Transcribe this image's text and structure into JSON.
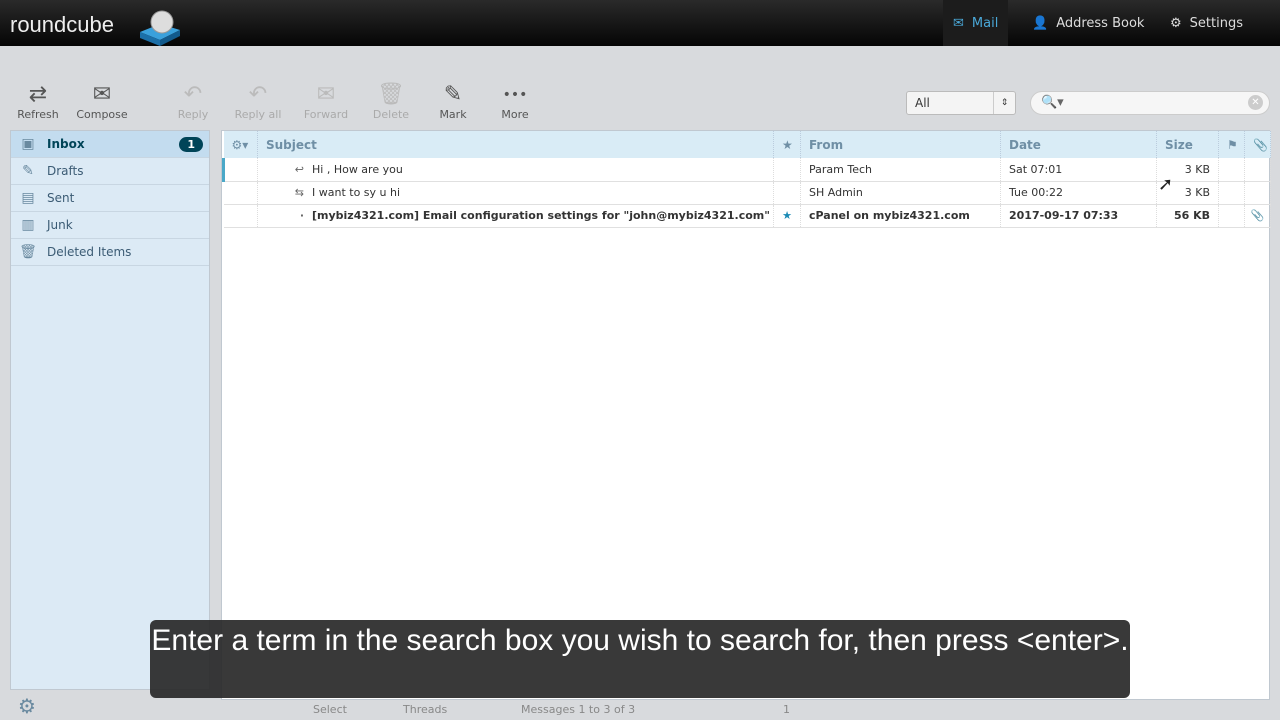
{
  "app": {
    "logo": "roundcube"
  },
  "topnav": [
    {
      "label": "Mail",
      "icon": "envelope-icon",
      "active": true
    },
    {
      "label": "Address Book",
      "icon": "person-icon"
    },
    {
      "label": "Settings",
      "icon": "gear-icon"
    }
  ],
  "toolbar": [
    {
      "label": "Refresh",
      "icon": "⇄",
      "enabled": true
    },
    {
      "label": "Compose",
      "icon": "✉",
      "enabled": true
    },
    {
      "label": "Reply",
      "icon": "↶",
      "enabled": false
    },
    {
      "label": "Reply all",
      "icon": "↶",
      "enabled": false
    },
    {
      "label": "Forward",
      "icon": "✉",
      "enabled": false
    },
    {
      "label": "Delete",
      "icon": "🗑",
      "enabled": false
    },
    {
      "label": "Mark",
      "icon": "✎",
      "enabled": true
    },
    {
      "label": "More",
      "icon": "•••",
      "enabled": true
    }
  ],
  "filter": {
    "value": "All"
  },
  "search": {
    "value": ""
  },
  "folders": [
    {
      "label": "Inbox",
      "count": "1",
      "icon": "▣"
    },
    {
      "label": "Drafts",
      "icon": "✎"
    },
    {
      "label": "Sent",
      "icon": "▤"
    },
    {
      "label": "Junk",
      "icon": "▥"
    },
    {
      "label": "Deleted Items",
      "icon": "🗑"
    }
  ],
  "columns": {
    "subject": "Subject",
    "from": "From",
    "date": "Date",
    "size": "Size"
  },
  "messages": [
    {
      "icon": "↩",
      "subject": "Hi , How are you",
      "from": "Param Tech",
      "date": "Sat 07:01",
      "size": "3 KB",
      "flagged": false,
      "attachment": false,
      "unread": false
    },
    {
      "icon": "⇆",
      "subject": "I want to sy u hi",
      "from": "SH Admin",
      "date": "Tue 00:22",
      "size": "3 KB",
      "flagged": false,
      "attachment": false,
      "unread": false
    },
    {
      "icon": "·",
      "subject": "[mybiz4321.com] Email configuration settings for \"john@mybiz4321.com\"",
      "from": "cPanel on mybiz4321.com",
      "date": "2017-09-17 07:33",
      "size": "56 KB",
      "flagged": true,
      "attachment": true,
      "unread": true
    }
  ],
  "footer": {
    "select": "Select",
    "threads": "Threads",
    "count": "Messages 1 to 3 of 3",
    "page": "1"
  },
  "caption": "Enter a term in the search box you wish to search for, then press <enter>.",
  "colors": {
    "accent": "#004458",
    "header": "#d9ecf6",
    "star": "#1a8ab5"
  }
}
